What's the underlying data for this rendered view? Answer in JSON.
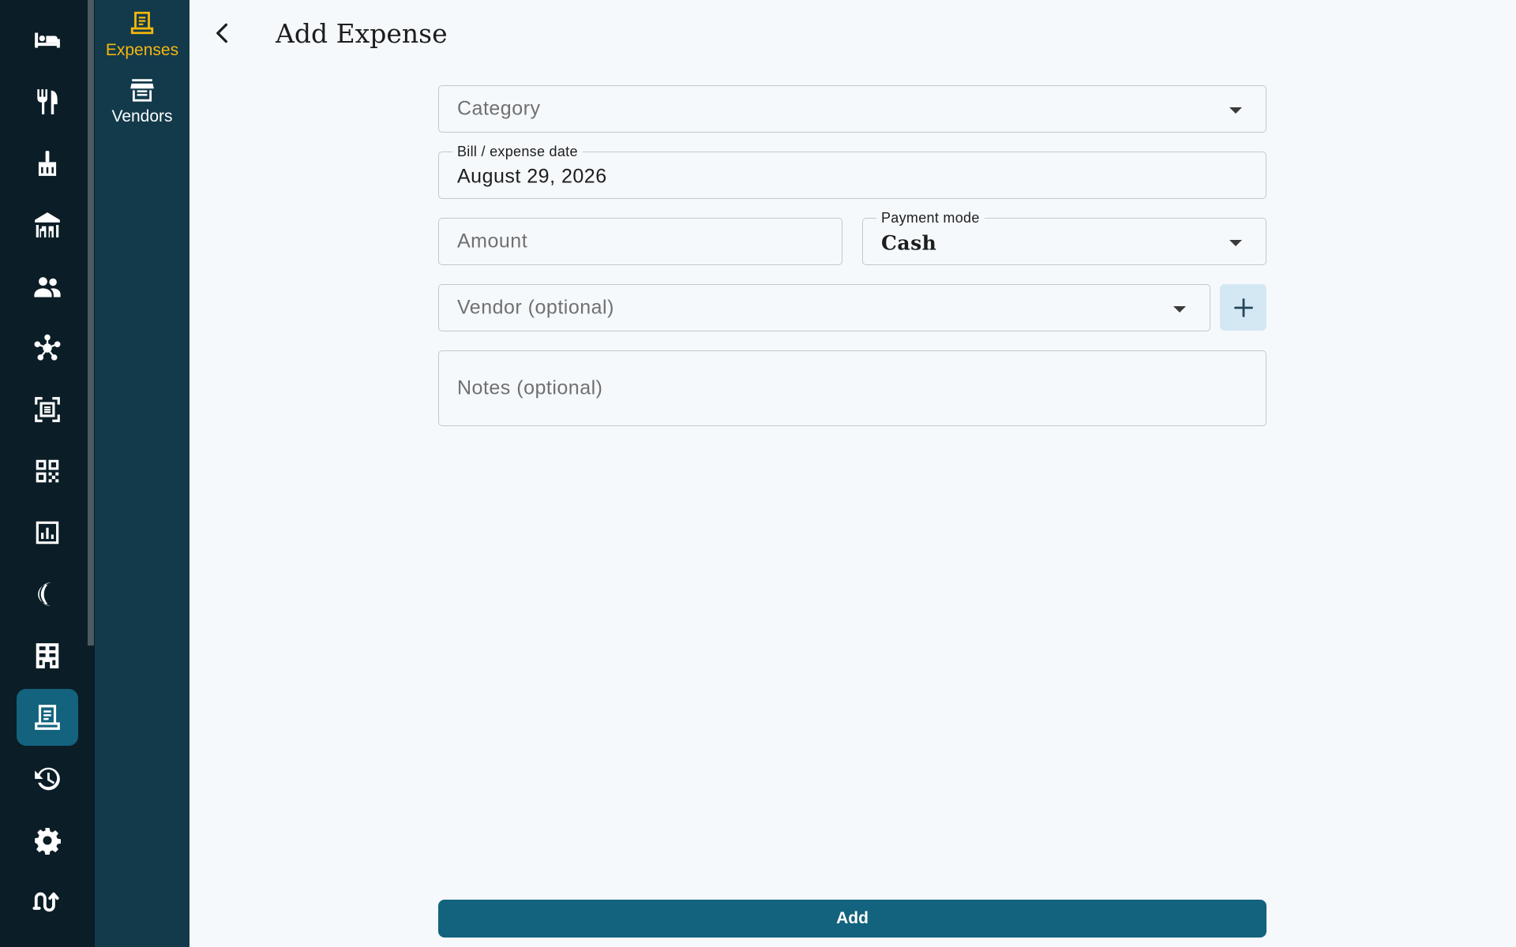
{
  "colors": {
    "rail_bg": "#0b1d26",
    "subnav_bg": "#123a4b",
    "accent": "#f5b60c",
    "primary": "#13637e",
    "page_bg": "#f5f9fc"
  },
  "rail": {
    "items": [
      {
        "icon": "bed-icon",
        "active": false
      },
      {
        "icon": "restaurant-icon",
        "active": false
      },
      {
        "icon": "cleaning-icon",
        "active": false
      },
      {
        "icon": "banquet-hall-icon",
        "active": false
      },
      {
        "icon": "guests-icon",
        "active": false
      },
      {
        "icon": "network-icon",
        "active": false
      },
      {
        "icon": "scan-document-icon",
        "active": false
      },
      {
        "icon": "qr-code-icon",
        "active": false
      },
      {
        "icon": "reports-icon",
        "active": false
      },
      {
        "icon": "night-audit-icon",
        "active": false
      },
      {
        "icon": "building-icon",
        "active": false
      },
      {
        "icon": "receipt-icon",
        "active": true
      },
      {
        "icon": "history-icon",
        "active": false
      },
      {
        "icon": "settings-icon",
        "active": false
      },
      {
        "icon": "sync-icon",
        "active": false
      }
    ]
  },
  "subnav": {
    "items": [
      {
        "label": "Expenses",
        "icon": "receipt-icon",
        "active": true
      },
      {
        "label": "Vendors",
        "icon": "store-icon",
        "active": false
      }
    ]
  },
  "header": {
    "title": "Add Expense"
  },
  "form": {
    "category": {
      "placeholder": "Category"
    },
    "bill_date": {
      "label": "Bill / expense date",
      "value": "August 29, 2026"
    },
    "amount": {
      "placeholder": "Amount"
    },
    "payment_mode": {
      "label": "Payment mode",
      "value": "Cash"
    },
    "vendor": {
      "placeholder": "Vendor (optional)"
    },
    "notes": {
      "placeholder": "Notes (optional)"
    },
    "submit_label": "Add"
  }
}
